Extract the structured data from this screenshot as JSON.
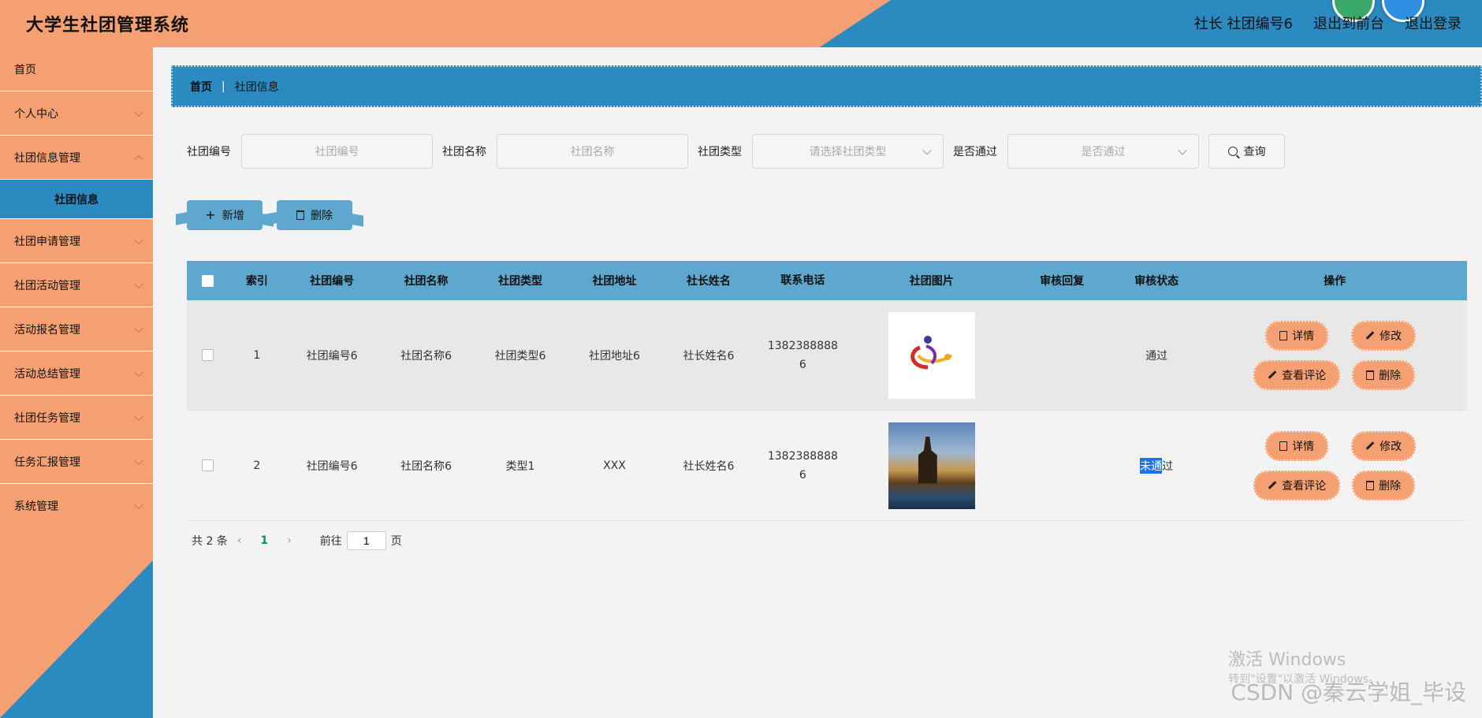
{
  "header": {
    "title": "大学生社团管理系统",
    "user_label": "社长 社团编号6",
    "to_front_label": "退出到前台",
    "logout_label": "退出登录"
  },
  "sidebar": {
    "items": [
      {
        "label": "首页"
      },
      {
        "label": "个人中心"
      },
      {
        "label": "社团信息管理"
      },
      {
        "label": "社团信息"
      },
      {
        "label": "社团申请管理"
      },
      {
        "label": "社团活动管理"
      },
      {
        "label": "活动报名管理"
      },
      {
        "label": "活动总结管理"
      },
      {
        "label": "社团任务管理"
      },
      {
        "label": "任务汇报管理"
      },
      {
        "label": "系统管理"
      }
    ]
  },
  "breadcrumb": {
    "home": "首页",
    "sep": "|",
    "current": "社团信息"
  },
  "filters": {
    "club_no_label": "社团编号",
    "club_no_placeholder": "社团编号",
    "club_name_label": "社团名称",
    "club_name_placeholder": "社团名称",
    "club_type_label": "社团类型",
    "club_type_placeholder": "请选择社团类型",
    "approved_label": "是否通过",
    "approved_placeholder": "是否通过",
    "query_label": "查询"
  },
  "actions": {
    "add_label": "新增",
    "delete_label": "删除"
  },
  "table": {
    "headers": [
      "索引",
      "社团编号",
      "社团名称",
      "社团类型",
      "社团地址",
      "社长姓名",
      "联系电话",
      "社团图片",
      "审核回复",
      "审核状态",
      "操作"
    ],
    "rows": [
      {
        "index": "1",
        "club_no": "社团编号6",
        "club_name": "社团名称6",
        "club_type": "社团类型6",
        "address": "社团地址6",
        "leader": "社长姓名6",
        "phone_a": "1382388888",
        "phone_b": "6",
        "reply": "",
        "status": "通过"
      },
      {
        "index": "2",
        "club_no": "社团编号6",
        "club_name": "社团名称6",
        "club_type": "类型1",
        "address": "XXX",
        "leader": "社长姓名6",
        "phone_a": "1382388888",
        "phone_b": "6",
        "reply": "",
        "status_hl": "未通",
        "status_rest": "过"
      }
    ],
    "ops": {
      "detail": "详情",
      "edit": "修改",
      "comments": "查看评论",
      "delete": "删除"
    }
  },
  "pagination": {
    "total": "共 2 条",
    "current": "1",
    "goto": "前往",
    "page_value": "1",
    "page_unit": "页"
  },
  "watermarks": {
    "csdn": "CSDN @秦云学姐_毕设",
    "win_title": "激活 Windows",
    "win_sub": "转到\"设置\"以激活 Windows。"
  }
}
